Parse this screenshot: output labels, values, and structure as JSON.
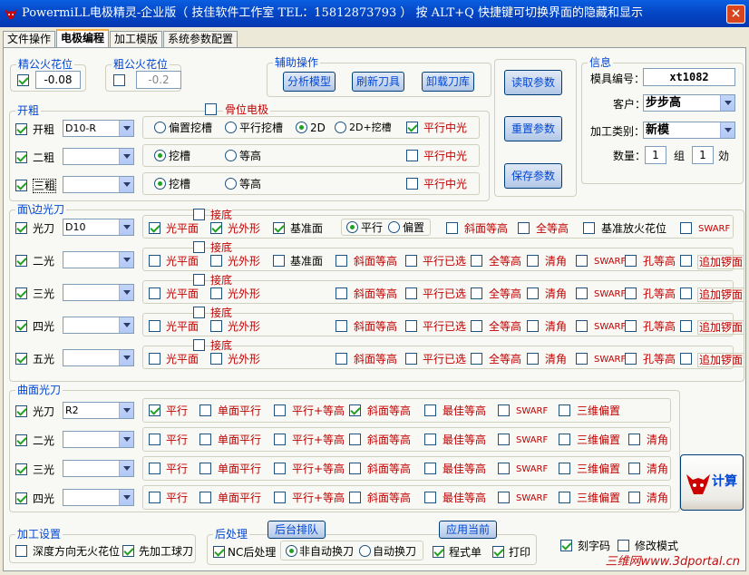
{
  "window": {
    "title": "PowermiLL电极精灵-企业版（ 技佳软件工作室   TEL：15812873793 ） 按 ALT+Q 快捷键可切换界面的隐藏和显示",
    "close": "×"
  },
  "tabs": [
    "文件操作",
    "电极编程",
    "加工模版",
    "系统参数配置"
  ],
  "spark": {
    "fine_title": "精公火花位",
    "fine_value": "-0.08",
    "rough_title": "粗公火花位",
    "rough_value": "-0.2"
  },
  "aux": {
    "title": "辅助操作",
    "analyze": "分析模型",
    "refresh": "刷新刀具",
    "unload": "卸载刀库"
  },
  "params": {
    "read": "读取参数",
    "reset": "重置参数",
    "save": "保存参数"
  },
  "info": {
    "title": "信息",
    "mold_label": "模具编号：",
    "mold_value": "xt1082",
    "client_label": "客户：",
    "client_value": "步步高",
    "type_label": "加工类别：",
    "type_value": "新模",
    "qty_label": "数量：",
    "qty_value": "1",
    "group_label": "组",
    "qty2_value": "1",
    "piece_label": "効"
  },
  "rough": {
    "title": "开粗",
    "position": "骨位电极",
    "rows": [
      {
        "label": "开粗",
        "tool": "D10-R"
      },
      {
        "label": "二粗",
        "tool": ""
      },
      {
        "label": "三粗",
        "tool": ""
      }
    ],
    "r1": [
      "偏置挖槽",
      "平行挖槽",
      "2D",
      "2D+挖槽"
    ],
    "pc": "平行中光",
    "dig": "挖槽",
    "eq": "等高"
  },
  "face": {
    "title": "面\\边光刀",
    "base": "接底",
    "rows": [
      {
        "label": "光刀",
        "tool": "D10"
      },
      {
        "label": "二光",
        "tool": ""
      },
      {
        "label": "三光",
        "tool": ""
      },
      {
        "label": "四光",
        "tool": ""
      },
      {
        "label": "五光",
        "tool": ""
      }
    ],
    "l": {
      "flat": "光平面",
      "outline": "光外形",
      "ref": "基准面",
      "par": "平行",
      "off": "偏置",
      "slope": "斜面等高",
      "alleq": "全等高",
      "refspark": "基准放火花位",
      "swarf": "SWARF",
      "paradone": "平行已选",
      "clear": "清角",
      "holeeq": "孔等高",
      "addsink": "追加锣面"
    }
  },
  "curve": {
    "title": "曲面光刀",
    "rows": [
      {
        "label": "光刀",
        "tool": "R2"
      },
      {
        "label": "二光",
        "tool": ""
      },
      {
        "label": "三光",
        "tool": ""
      },
      {
        "label": "四光",
        "tool": ""
      }
    ],
    "l": {
      "par": "平行",
      "facepar": "单面平行",
      "pareq": "平行+等高",
      "slope": "斜面等高",
      "best": "最佳等高",
      "swarf": "SWARF",
      "off3d": "三维偏置",
      "clear": "清角"
    }
  },
  "machining": {
    "title": "加工设置",
    "depth": "深度方向无火花位",
    "ball": "先加工球刀"
  },
  "post": {
    "title": "后处理",
    "queue": "后台排队",
    "apply": "应用当前",
    "nc": "NC后处理",
    "nonauto": "非自动换刀",
    "auto": "自动换刀",
    "prog": "程式单",
    "print": "打印"
  },
  "extra": {
    "engrave": "刻字码",
    "modify": "修改模式",
    "calc": "计算",
    "watermark": "三维网www.3dportal.cn"
  }
}
